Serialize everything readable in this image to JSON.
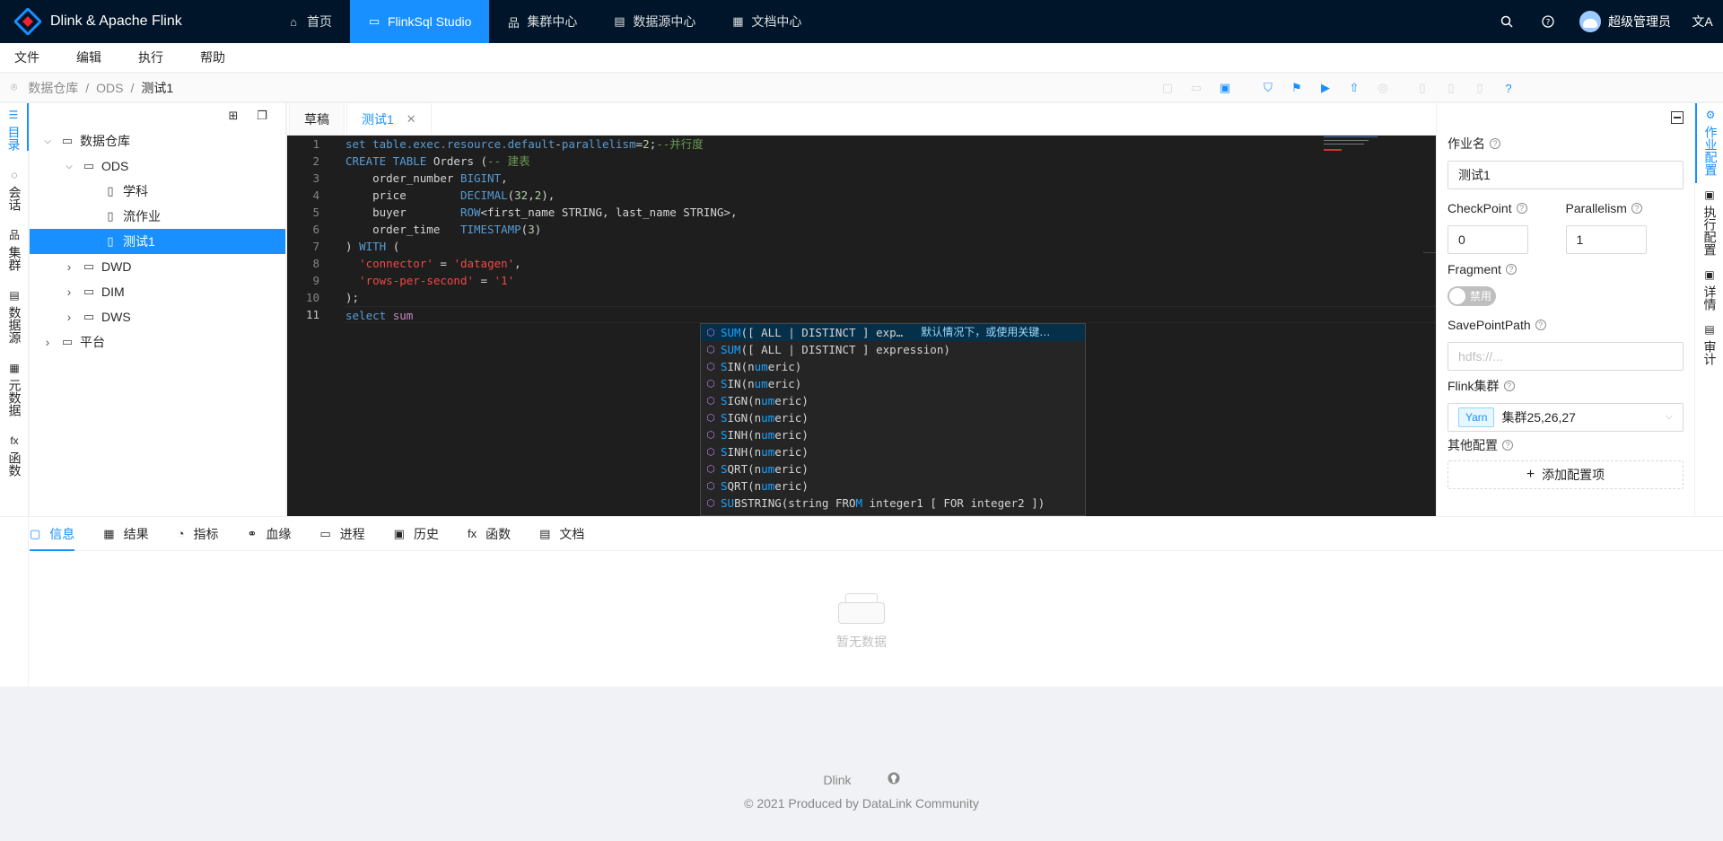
{
  "app": {
    "title": "Dlink & Apache Flink"
  },
  "nav": {
    "items": [
      {
        "icon": "home-icon",
        "glyph": "⌂",
        "label": "首页",
        "active": false
      },
      {
        "icon": "monitor-icon",
        "glyph": "▭",
        "label": "FlinkSql Studio",
        "active": true
      },
      {
        "icon": "cluster-icon",
        "glyph": "品",
        "label": "集群中心",
        "active": false
      },
      {
        "icon": "datasource-icon",
        "glyph": "▤",
        "label": "数据源中心",
        "active": false
      },
      {
        "icon": "doc-icon",
        "glyph": "▦",
        "label": "文档中心",
        "active": false
      }
    ]
  },
  "user": {
    "name": "超级管理员"
  },
  "menubar": {
    "items": [
      "文件",
      "编辑",
      "执行",
      "帮助"
    ]
  },
  "breadcrumb": {
    "items": [
      "数据仓库",
      "ODS",
      "测试1"
    ]
  },
  "leftrail": {
    "items": [
      {
        "glyph": "☰",
        "label": "目录",
        "active": true
      },
      {
        "glyph": "◌",
        "label": "会话",
        "active": false
      },
      {
        "glyph": "品",
        "label": "集群",
        "active": false
      },
      {
        "glyph": "▤",
        "label": "数据源",
        "active": false
      },
      {
        "glyph": "▦",
        "label": "元数据",
        "active": false
      },
      {
        "glyph": "fx",
        "label": "函数",
        "active": false
      }
    ]
  },
  "tree": {
    "nodes": [
      {
        "label": "数据仓库",
        "level": 0,
        "type": "folder",
        "expanded": true,
        "selected": false
      },
      {
        "label": "ODS",
        "level": 1,
        "type": "folder",
        "expanded": true,
        "selected": false
      },
      {
        "label": "学科",
        "level": 2,
        "type": "file",
        "expanded": null,
        "selected": false
      },
      {
        "label": "流作业",
        "level": 2,
        "type": "file",
        "expanded": null,
        "selected": false
      },
      {
        "label": "测试1",
        "level": 2,
        "type": "file",
        "expanded": null,
        "selected": true
      },
      {
        "label": "DWD",
        "level": 1,
        "type": "folder",
        "expanded": false,
        "selected": false
      },
      {
        "label": "DIM",
        "level": 1,
        "type": "folder",
        "expanded": false,
        "selected": false
      },
      {
        "label": "DWS",
        "level": 1,
        "type": "folder",
        "expanded": false,
        "selected": false
      },
      {
        "label": "平台",
        "level": 0,
        "type": "folder",
        "expanded": false,
        "selected": false
      }
    ]
  },
  "tabs": {
    "items": [
      {
        "label": "草稿",
        "active": false,
        "closable": false
      },
      {
        "label": "测试1",
        "active": true,
        "closable": true
      }
    ]
  },
  "editor": {
    "line_numbers": [
      "1",
      "2",
      "3",
      "4",
      "5",
      "6",
      "7",
      "8",
      "9",
      "10",
      "11"
    ],
    "lines": [
      [
        [
          "k",
          "set table.exec.resource.default"
        ],
        [
          "o",
          "-"
        ],
        [
          "k",
          "parallelism"
        ],
        [
          "o",
          "="
        ],
        [
          "n",
          "2"
        ],
        [
          "o",
          ";"
        ],
        [
          "c",
          "--并行度"
        ]
      ],
      [
        [
          "k",
          "CREATE TABLE"
        ],
        [
          "o",
          " Orders ("
        ],
        [
          "c",
          "-- 建表"
        ]
      ],
      [
        [
          "o",
          "    order_number "
        ],
        [
          "k",
          "BIGINT"
        ],
        [
          "o",
          ","
        ]
      ],
      [
        [
          "o",
          "    price        "
        ],
        [
          "k",
          "DECIMAL"
        ],
        [
          "o",
          "("
        ],
        [
          "n",
          "32"
        ],
        [
          "o",
          ","
        ],
        [
          "n",
          "2"
        ],
        [
          "o",
          "),"
        ]
      ],
      [
        [
          "o",
          "    buyer        "
        ],
        [
          "k",
          "ROW"
        ],
        [
          "o",
          "<first_name STRING, last_name STRING>,"
        ]
      ],
      [
        [
          "o",
          "    order_time   "
        ],
        [
          "k",
          "TIMESTAMP"
        ],
        [
          "o",
          "("
        ],
        [
          "n",
          "3"
        ],
        [
          "o",
          ")"
        ]
      ],
      [
        [
          "o",
          ") "
        ],
        [
          "k",
          "WITH"
        ],
        [
          "o",
          " ("
        ]
      ],
      [
        [
          "o",
          "  "
        ],
        [
          "str",
          "'connector'"
        ],
        [
          "o",
          " = "
        ],
        [
          "str",
          "'datagen'"
        ],
        [
          "o",
          ","
        ]
      ],
      [
        [
          "o",
          "  "
        ],
        [
          "str",
          "'rows-per-second'"
        ],
        [
          "o",
          " = "
        ],
        [
          "str",
          "'1'"
        ]
      ],
      [
        [
          "o",
          ");"
        ]
      ],
      [
        [
          "k",
          "select"
        ],
        [
          "o",
          " "
        ],
        [
          "p",
          "sum"
        ]
      ]
    ],
    "suggestions": [
      {
        "pre": "",
        "hl": "SUM",
        "post": "([ ALL | DISTINCT ] exp…",
        "desc": "默认情况下，或使用关键…",
        "selected": true
      },
      {
        "pre": "",
        "hl": "SUM",
        "post": "([ ALL | DISTINCT ] expression)",
        "desc": "",
        "selected": false
      },
      {
        "pre": "",
        "hl": "S",
        "post": "IN(n",
        "hl2": "um",
        "post2": "eric)",
        "desc": "",
        "selected": false
      },
      {
        "pre": "",
        "hl": "S",
        "post": "IN(n",
        "hl2": "um",
        "post2": "eric)",
        "desc": "",
        "selected": false
      },
      {
        "pre": "",
        "hl": "S",
        "post": "IGN(n",
        "hl2": "um",
        "post2": "eric)",
        "desc": "",
        "selected": false
      },
      {
        "pre": "",
        "hl": "S",
        "post": "IGN(n",
        "hl2": "um",
        "post2": "eric)",
        "desc": "",
        "selected": false
      },
      {
        "pre": "",
        "hl": "S",
        "post": "INH(n",
        "hl2": "um",
        "post2": "eric)",
        "desc": "",
        "selected": false
      },
      {
        "pre": "",
        "hl": "S",
        "post": "INH(n",
        "hl2": "um",
        "post2": "eric)",
        "desc": "",
        "selected": false
      },
      {
        "pre": "",
        "hl": "S",
        "post": "QRT(n",
        "hl2": "um",
        "post2": "eric)",
        "desc": "",
        "selected": false
      },
      {
        "pre": "",
        "hl": "S",
        "post": "QRT(n",
        "hl2": "um",
        "post2": "eric)",
        "desc": "",
        "selected": false
      },
      {
        "pre": "",
        "hl": "SU",
        "post": "BSTRING(string FRO",
        "hl2": "M",
        "post2": " integer1 [ FOR integer2 ])",
        "desc": "",
        "selected": false
      }
    ]
  },
  "jobconfig": {
    "name_label": "作业名",
    "name_value": "测试1",
    "checkpoint_label": "CheckPoint",
    "checkpoint_value": "0",
    "parallelism_label": "Parallelism",
    "parallelism_value": "1",
    "fragment_label": "Fragment",
    "fragment_switch": "禁用",
    "savepoint_label": "SavePointPath",
    "savepoint_placeholder": "hdfs://...",
    "cluster_label": "Flink集群",
    "cluster_tag": "Yarn",
    "cluster_value": "集群25,26,27",
    "other_label": "其他配置",
    "add_config": "添加配置项"
  },
  "rightrail": {
    "items": [
      {
        "glyph": "⚙",
        "label": "作业配置",
        "active": true
      },
      {
        "glyph": "▣",
        "label": "执行配置",
        "active": false
      },
      {
        "glyph": "▣",
        "label": "详情",
        "active": false
      },
      {
        "glyph": "▤",
        "label": "审计",
        "active": false
      }
    ]
  },
  "bottomtabs": {
    "items": [
      {
        "glyph": "▢",
        "label": "信息",
        "active": true
      },
      {
        "glyph": "▦",
        "label": "结果",
        "active": false
      },
      {
        "glyph": "◔",
        "label": "指标",
        "active": false
      },
      {
        "glyph": "⚭",
        "label": "血缘",
        "active": false
      },
      {
        "glyph": "▭",
        "label": "进程",
        "active": false
      },
      {
        "glyph": "▣",
        "label": "历史",
        "active": false
      },
      {
        "glyph": "fx",
        "label": "函数",
        "active": false
      },
      {
        "glyph": "▤",
        "label": "文档",
        "active": false
      }
    ]
  },
  "empty": {
    "text": "暂无数据"
  },
  "footer": {
    "link1": "Dlink",
    "copyright": "© 2021 Produced by DataLink Community"
  }
}
